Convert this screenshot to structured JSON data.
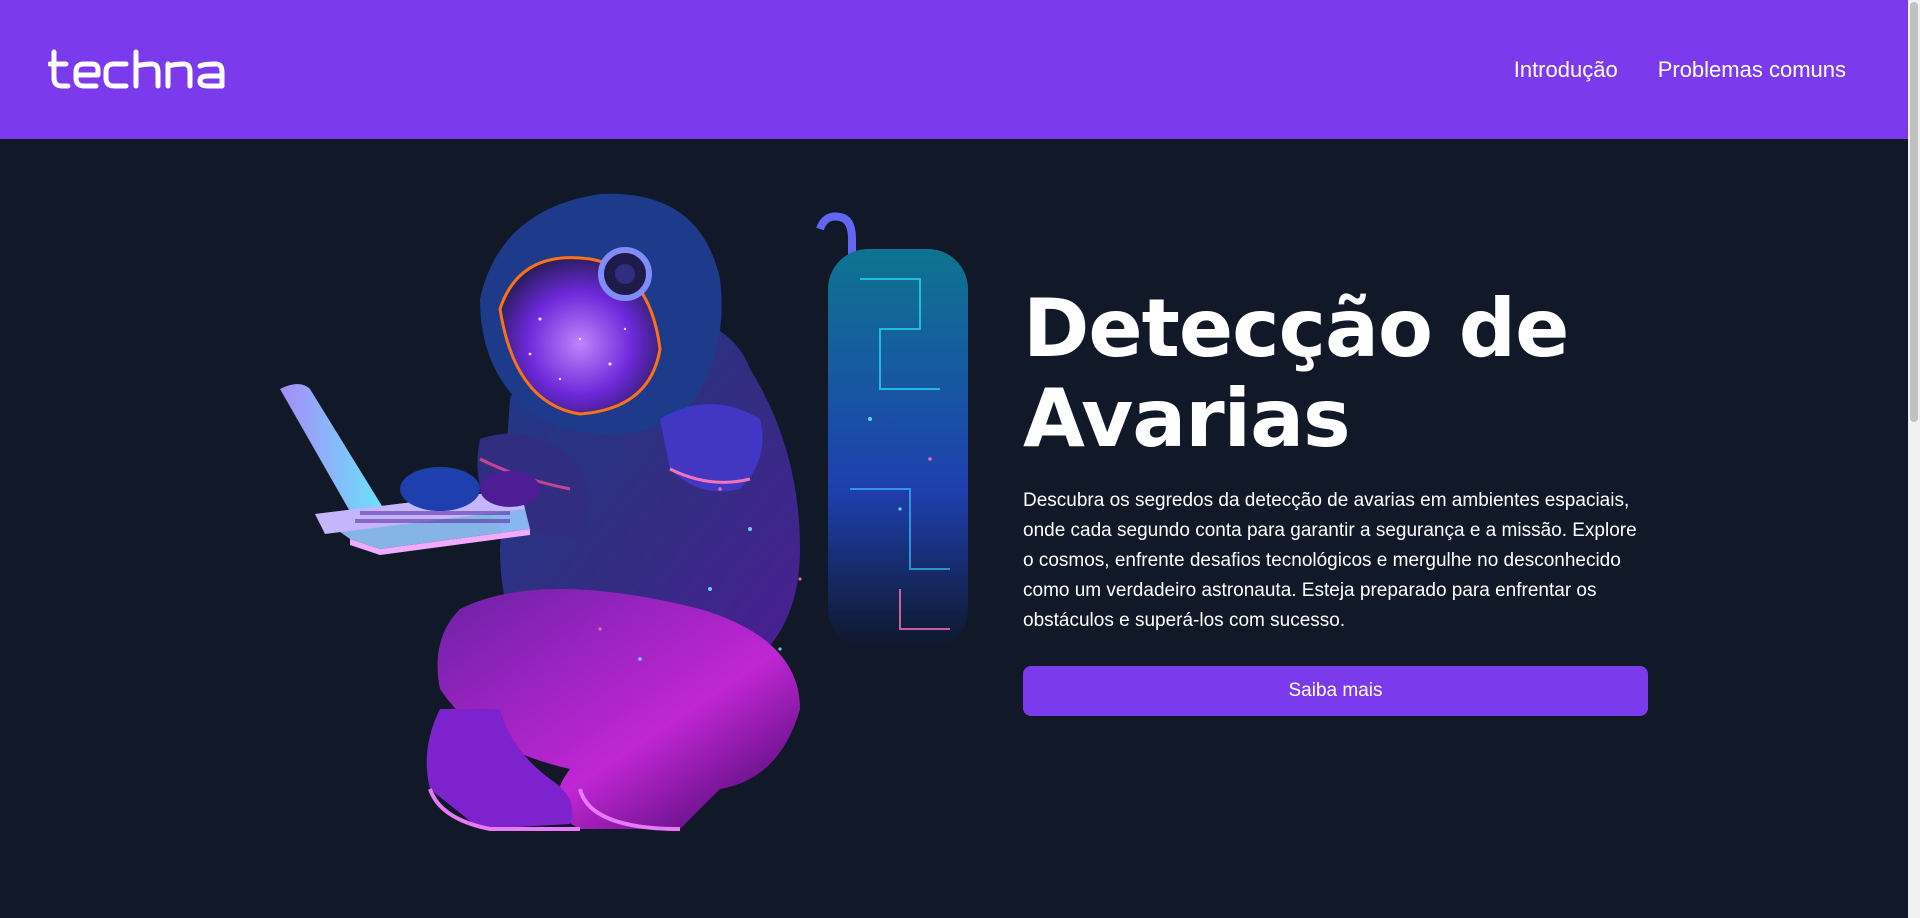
{
  "header": {
    "logo_text": "techna",
    "nav": [
      {
        "label": "Introdução"
      },
      {
        "label": "Problemas comuns"
      }
    ]
  },
  "hero": {
    "title": "Detecção de Avarias",
    "description": "Descubra os segredos da detecção de avarias em ambientes espaciais, onde cada segundo conta para garantir a segurança e a missão. Explore o cosmos, enfrente desafios tecnológicos e mergulhe no desconhecido como um verdadeiro astronauta. Esteja preparado para enfrentar os obstáculos e superá-los com sucesso.",
    "button_label": "Saiba mais",
    "illustration": "astronaut-with-laptop"
  },
  "colors": {
    "header_bg": "#7c3aed",
    "page_bg": "#111827",
    "accent": "#7c3aed",
    "text": "#ffffff"
  }
}
